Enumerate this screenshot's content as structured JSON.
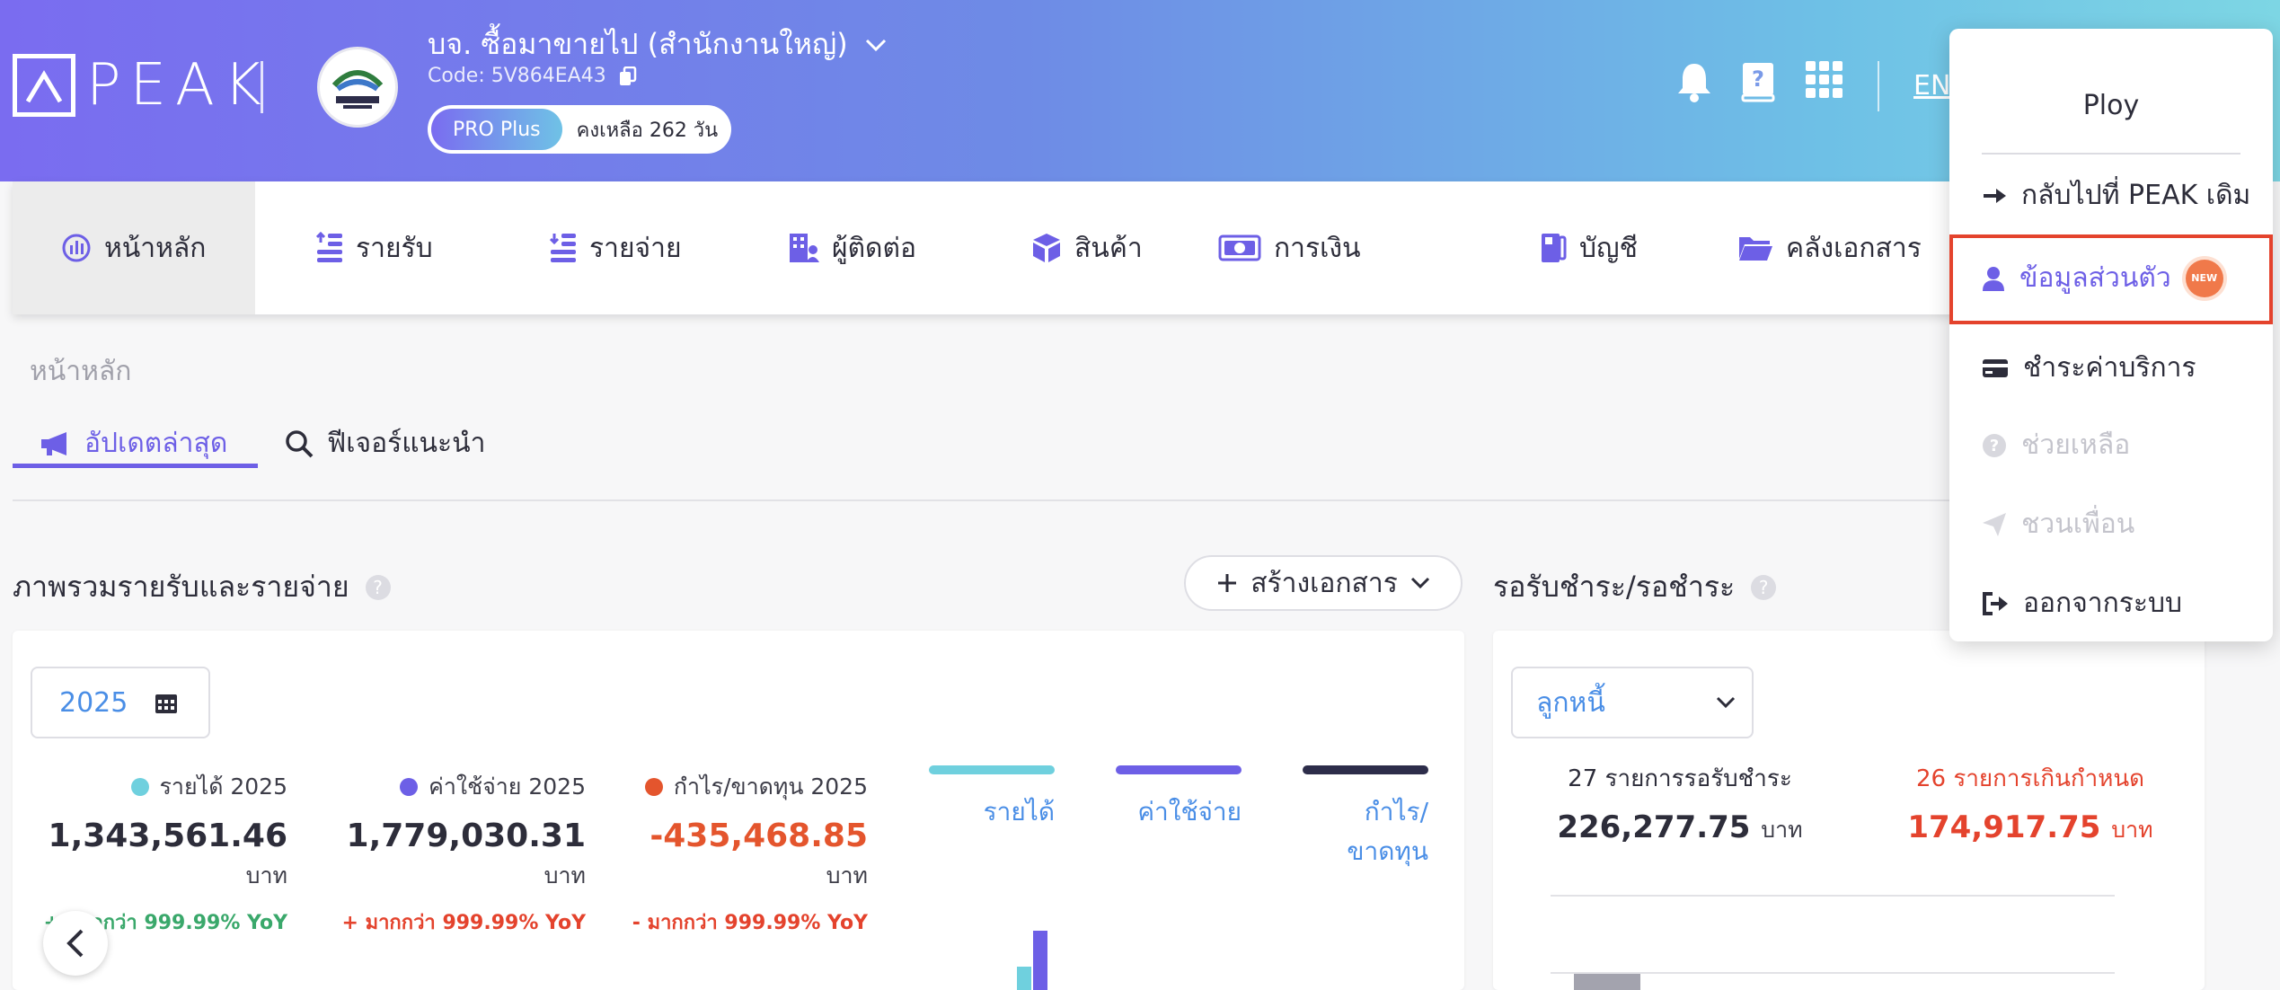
{
  "header": {
    "logo_text": "PEAK",
    "company_name": "บจ. ซื้อมาขายไป (สำนักงานใหญ่)",
    "company_code": "Code: 5V864EA43",
    "plan_label": "PRO Plus",
    "plan_remaining": "คงเหลือ 262 วัน",
    "language": "EN"
  },
  "nav": {
    "items": [
      {
        "label": "หน้าหลัก",
        "icon": "dashboard-icon"
      },
      {
        "label": "รายรับ",
        "icon": "income-icon"
      },
      {
        "label": "รายจ่าย",
        "icon": "expense-icon"
      },
      {
        "label": "ผู้ติดต่อ",
        "icon": "contacts-icon"
      },
      {
        "label": "สินค้า",
        "icon": "product-box-icon"
      },
      {
        "label": "การเงิน",
        "icon": "money-icon"
      },
      {
        "label": "บัญชี",
        "icon": "ledger-icon"
      },
      {
        "label": "คลังเอกสาร",
        "icon": "folder-icon"
      }
    ]
  },
  "breadcrumb": "หน้าหลัก",
  "tabs": {
    "updates": "อัปเดตล่าสุด",
    "features": "ฟีเจอร์แนะนำ"
  },
  "overview": {
    "title": "ภาพรวมรายรับและรายจ่าย",
    "create_button": "สร้างเอกสาร",
    "year": "2025",
    "stats": [
      {
        "label": "รายได้ 2025",
        "value": "1,343,561.46",
        "unit": "บาท",
        "yoy": "+ มากกว่า 999.99% YoY",
        "dot_color": "#6fd0de",
        "value_color": "#2d2d3a",
        "yoy_color": "#3aa86b"
      },
      {
        "label": "ค่าใช้จ่าย 2025",
        "value": "1,779,030.31",
        "unit": "บาท",
        "yoy": "+ มากกว่า 999.99% YoY",
        "dot_color": "#6d5fe6",
        "value_color": "#2d2d3a",
        "yoy_color": "#e4432d"
      },
      {
        "label": "กำไร/ขาดทุน 2025",
        "value": "-435,468.85",
        "unit": "บาท",
        "yoy": "- มากกว่า 999.99% YoY",
        "dot_color": "#e4552d",
        "value_color": "#e4552d",
        "yoy_color": "#e4432d"
      }
    ],
    "legend": [
      {
        "label": "รายได้",
        "color": "#6fd0de"
      },
      {
        "label": "ค่าใช้จ่าย",
        "color": "#6d5fe6"
      },
      {
        "label": "กำไร/ขาดทุน",
        "color": "#2d2d4a"
      }
    ]
  },
  "receivables": {
    "title": "รอรับชำระ/รอชำระ",
    "select_value": "ลูกหนี้",
    "pending_label": "27 รายการรอรับชำระ",
    "pending_value": "226,277.75",
    "overdue_label": "26 รายการเกินกำหนด",
    "overdue_value": "174,917.75",
    "unit": "บาท"
  },
  "user_menu": {
    "user_name": "Ploy",
    "items": [
      {
        "label": "กลับไปที่ PEAK เดิม",
        "icon": "arrow-right-icon"
      },
      {
        "label": "ข้อมูลส่วนตัว",
        "icon": "user-icon",
        "badge": "NEW"
      },
      {
        "label": "ชำระค่าบริการ",
        "icon": "credit-card-icon"
      },
      {
        "label": "ช่วยเหลือ",
        "icon": "help-icon"
      },
      {
        "label": "ชวนเพื่อน",
        "icon": "send-icon"
      },
      {
        "label": "ออกจากระบบ",
        "icon": "logout-icon"
      }
    ]
  }
}
